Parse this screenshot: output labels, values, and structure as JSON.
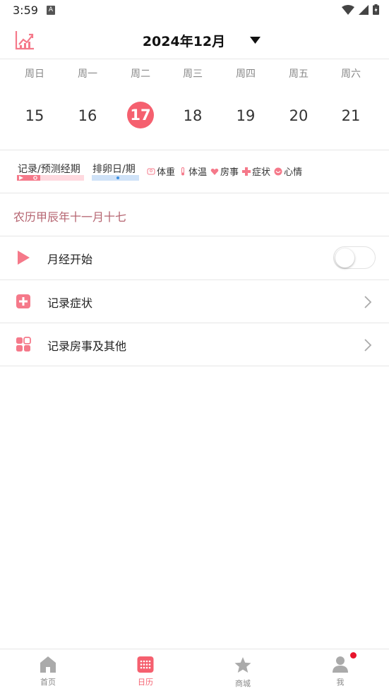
{
  "status_bar": {
    "time": "3:59",
    "notification_glyph": "A"
  },
  "header": {
    "month": "2024年12月"
  },
  "weekdays": [
    "周日",
    "周一",
    "周二",
    "周三",
    "周四",
    "周五",
    "周六"
  ],
  "dates": [
    "15",
    "16",
    "17",
    "18",
    "19",
    "20",
    "21"
  ],
  "legend": {
    "record": "记录/预测经期",
    "ovulation": "排卵日/期",
    "items": [
      "体重",
      "体温",
      "房事",
      "症状",
      "心情"
    ]
  },
  "lunar_date": "农历甲辰年十一月十七",
  "rows": [
    {
      "label": "月经开始",
      "toggle_on": false
    },
    {
      "label": "记录症状"
    },
    {
      "label": "记录房事及其他"
    }
  ],
  "bottom_nav": [
    {
      "label": "首页"
    },
    {
      "label": "日历"
    },
    {
      "label": "商城"
    },
    {
      "label": "我"
    }
  ],
  "colors": {
    "accent": "#f5606f",
    "lunar": "#b56470",
    "ovulation": "#cfe2f8",
    "period": "#ffd9df"
  }
}
